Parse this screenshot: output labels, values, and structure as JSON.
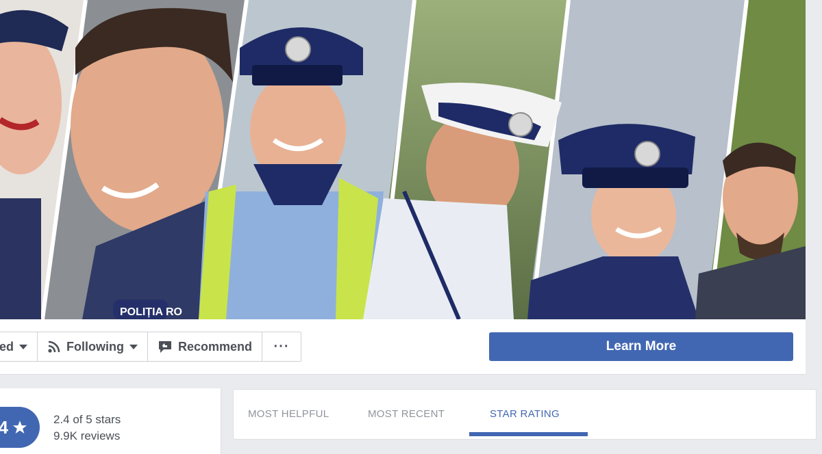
{
  "cover": {
    "image": "police-officers-cover-photo",
    "badge_text": "POLIȚIA RO"
  },
  "actions": {
    "liked_label": "ed",
    "following_label": "Following",
    "recommend_label": "Recommend",
    "more_label": "···",
    "learn_more_label": "Learn More"
  },
  "reviews": {
    "badge_value": "4",
    "badge_icon": "star-icon",
    "rating_text": "2.4 of 5 stars",
    "count_text": "9.9K reviews"
  },
  "tabs": {
    "items": [
      {
        "label": "MOST HELPFUL"
      },
      {
        "label": "MOST RECENT"
      },
      {
        "label": "STAR RATING"
      }
    ],
    "active_index": 2
  },
  "colors": {
    "accent": "#4267b2",
    "background": "#e9ebee",
    "tab_inactive": "#90949c"
  }
}
